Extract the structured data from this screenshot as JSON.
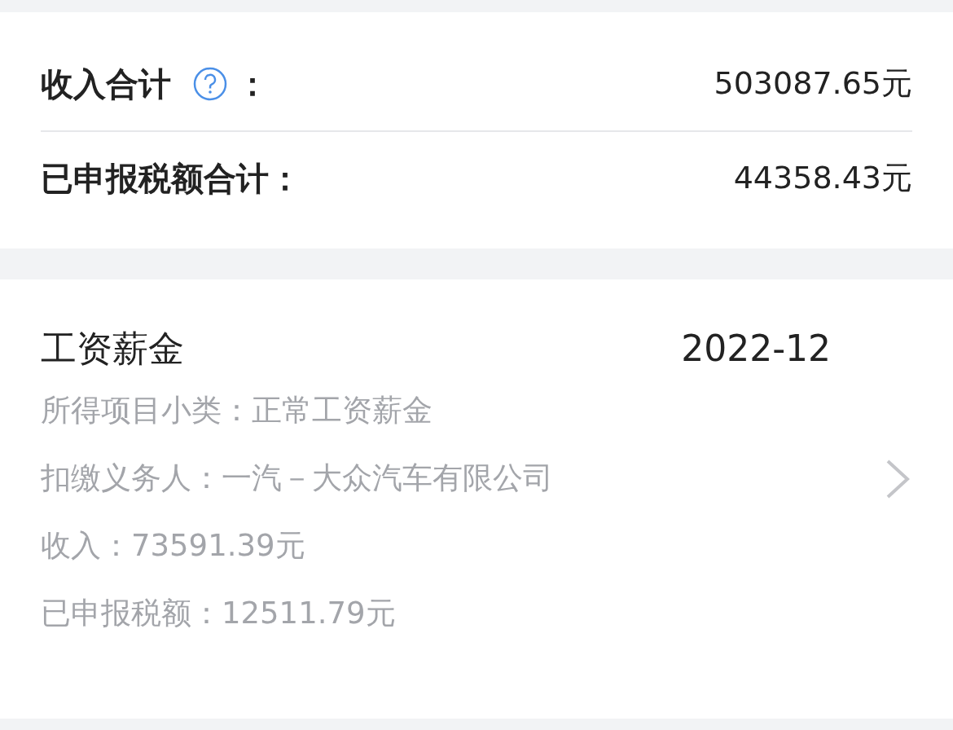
{
  "summary": {
    "rows": [
      {
        "kind": "with_help",
        "label": "收入合计",
        "suffix": "：",
        "value": "503087.65元"
      },
      {
        "kind": "plain",
        "label": "已申报税额合计：",
        "value": "44358.43元"
      }
    ]
  },
  "record": {
    "title": "工资薪金",
    "period": "2022-12",
    "details": [
      "所得项目小类：正常工资薪金",
      "扣缴义务人：一汽－大众汽车有限公司",
      "收入：73591.39元",
      "已申报税额：12511.79元"
    ]
  }
}
